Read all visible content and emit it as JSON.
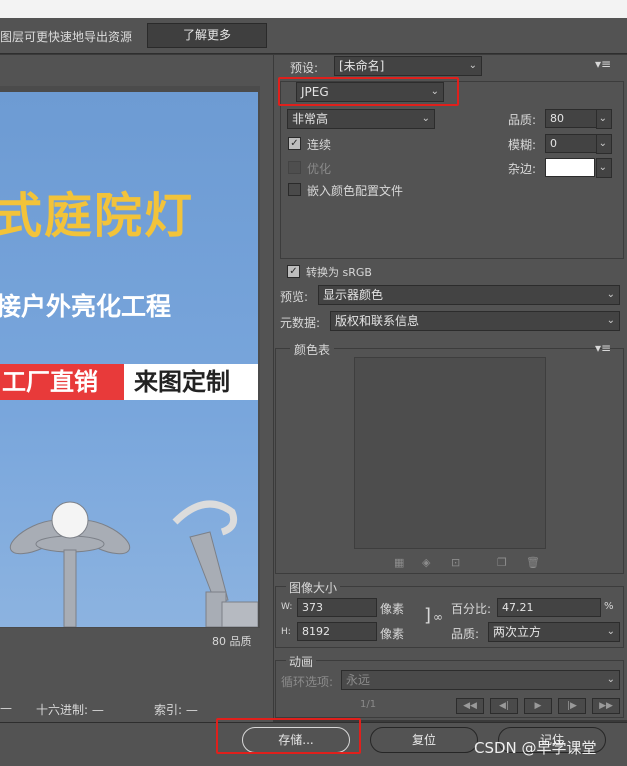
{
  "header": {
    "tip_text": "图层可更快速地导出资源",
    "learn_more_label": "了解更多"
  },
  "preview": {
    "poster_line1": "式庭院灯",
    "poster_line2": "接户外亮化工程",
    "poster_red": "工厂直销",
    "poster_white": "来图定制",
    "quality_note": "80 品质"
  },
  "status": {
    "dash_left": "—",
    "hex_label": "十六进制: —",
    "index_label": "索引: —"
  },
  "settings": {
    "preset_label": "预设:",
    "preset_value": "[未命名]",
    "format_value": "JPEG",
    "quality_preset_value": "非常高",
    "quality_label": "品质:",
    "quality_value": "80",
    "progressive_label": "连续",
    "blur_label": "模糊:",
    "blur_value": "0",
    "optimized_label": "优化",
    "matte_label": "杂边:",
    "embed_profile_label": "嵌入颜色配置文件",
    "convert_srgb_label": "转换为 sRGB",
    "preview_label": "预览:",
    "preview_value": "显示器颜色",
    "metadata_label": "元数据:",
    "metadata_value": "版权和联系信息",
    "color_table_label": "颜色表"
  },
  "image_size": {
    "title": "图像大小",
    "w_label": "W:",
    "w_value": "373",
    "h_label": "H:",
    "h_value": "8192",
    "unit": "像素",
    "percent_label": "百分比:",
    "percent_value": "47.21",
    "percent_unit": "%",
    "quality_label": "品质:",
    "quality_value": "两次立方"
  },
  "animation": {
    "title": "动画",
    "loop_label": "循环选项:",
    "loop_value": "永远",
    "frame_counter": "1/1"
  },
  "buttons": {
    "save": "存储...",
    "reset": "复位",
    "remember": "记住"
  },
  "watermark": "CSDN @早学课堂",
  "colors": {
    "highlight": "#e0201c",
    "panel": "#535353",
    "poster_title": "#f2c33a",
    "poster_red": "#e83a3a"
  }
}
